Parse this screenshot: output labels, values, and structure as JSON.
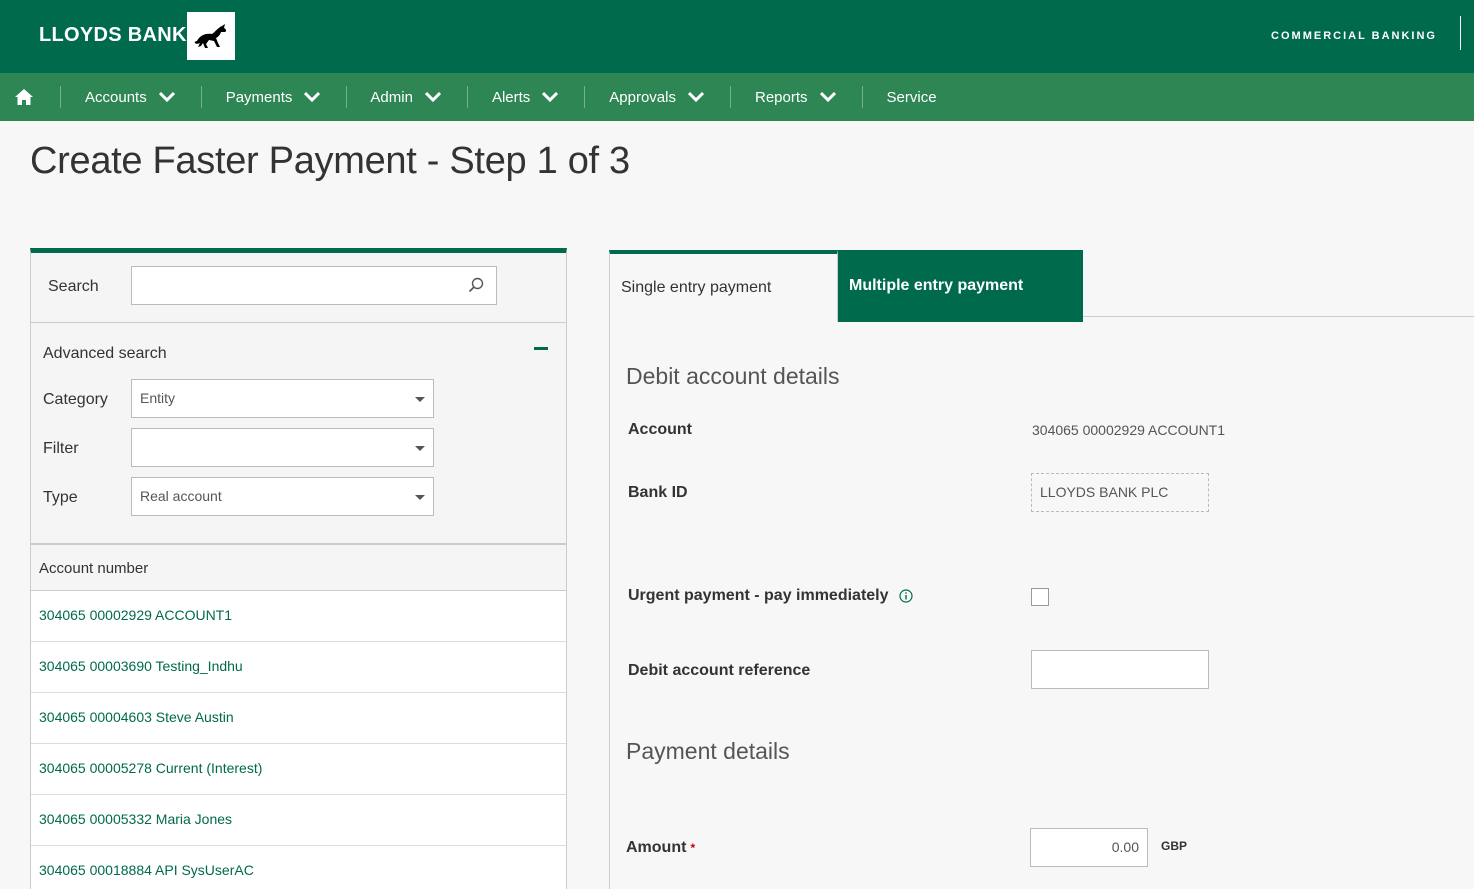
{
  "header": {
    "brand": "LLOYDS BANK",
    "segment": "COMMERCIAL BANKING"
  },
  "nav": {
    "items": [
      {
        "label": "Accounts",
        "has_menu": true
      },
      {
        "label": "Payments",
        "has_menu": true
      },
      {
        "label": "Admin",
        "has_menu": true
      },
      {
        "label": "Alerts",
        "has_menu": true
      },
      {
        "label": "Approvals",
        "has_menu": true
      },
      {
        "label": "Reports",
        "has_menu": true
      },
      {
        "label": "Service",
        "has_menu": false
      }
    ]
  },
  "page": {
    "title": "Create Faster Payment - Step 1 of 3"
  },
  "left": {
    "search_label": "Search",
    "search_value": "",
    "advanced_title": "Advanced search",
    "category_label": "Category",
    "category_value": "Entity",
    "filter_label": "Filter",
    "filter_value": "",
    "type_label": "Type",
    "type_value": "Real account",
    "list_header": "Account number",
    "accounts": [
      "304065 00002929 ACCOUNT1",
      "304065 00003690 Testing_Indhu",
      "304065 00004603 Steve Austin",
      "304065 00005278 Current (Interest)",
      "304065 00005332 Maria Jones",
      "304065 00018884 API SysUserAC"
    ]
  },
  "tabs": {
    "single": "Single entry payment",
    "multiple": "Multiple entry payment"
  },
  "debit": {
    "section_title": "Debit account details",
    "account_label": "Account",
    "account_value": "304065 00002929 ACCOUNT1",
    "bank_id_label": "Bank ID",
    "bank_id_value": "LLOYDS BANK PLC",
    "urgent_label": "Urgent payment - pay immediately",
    "urgent_checked": false,
    "reference_label": "Debit account reference",
    "reference_value": ""
  },
  "payment": {
    "section_title": "Payment details",
    "amount_label": "Amount",
    "required_mark": "*",
    "amount_value": "0.00",
    "currency": "GBP"
  },
  "colors": {
    "brand_dark": "#006a4d",
    "nav_green": "#2e8655",
    "link_green": "#006a4d"
  }
}
